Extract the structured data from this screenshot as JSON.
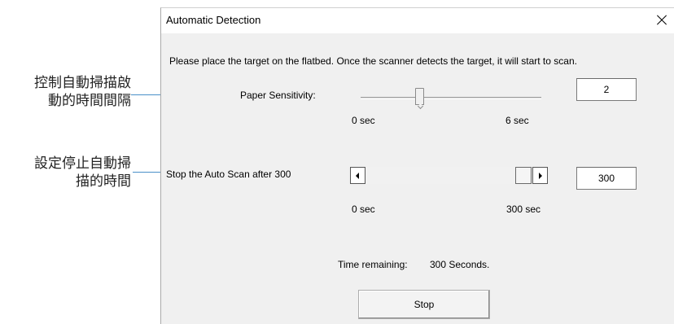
{
  "annotations": {
    "callout1": [
      "控制自動掃描啟",
      "動的時間間隔"
    ],
    "callout2": [
      "設定停止自動掃",
      "描的時間"
    ]
  },
  "dialog": {
    "title": "Automatic Detection",
    "close_icon": "close-icon",
    "instructions": "Please place the target on the flatbed. Once the scanner detects the target, it will start to scan.",
    "paper_sensitivity": {
      "label": "Paper Sensitivity:",
      "min_label": "0  sec",
      "max_label": "6  sec",
      "value": "2",
      "min": 0,
      "max": 6
    },
    "auto_scan_stop": {
      "label": "Stop the Auto Scan after 300",
      "min_label": "0 sec",
      "max_label": "300 sec",
      "value": "300",
      "min": 0,
      "max": 300
    },
    "time_remaining": {
      "label": "Time remaining:",
      "value": "300 Seconds."
    },
    "stop_label": "Stop"
  }
}
